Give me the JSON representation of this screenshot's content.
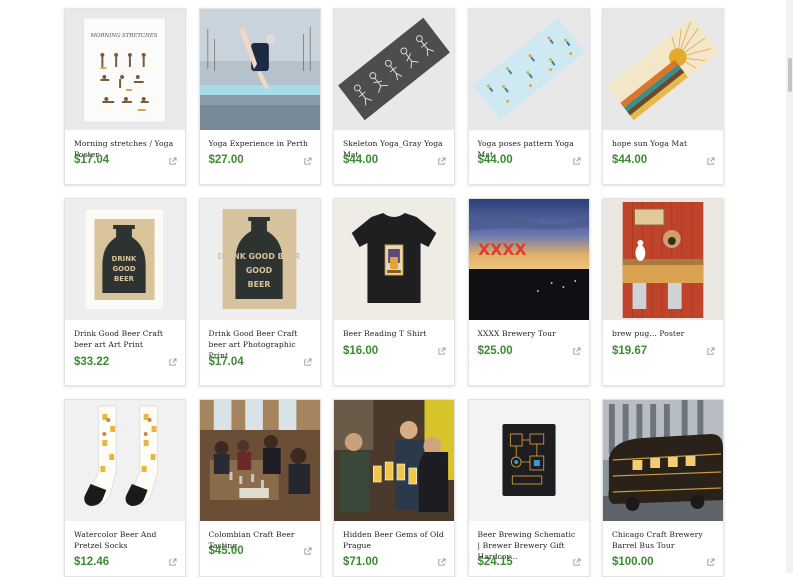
{
  "products": [
    {
      "title": "Morning stretches / Yoga Poster",
      "price": "$17.04",
      "image": "morning-stretches-poster"
    },
    {
      "title": "Yoga Experience in Perth",
      "price": "$27.00",
      "image": "yoga-paddleboard-photo"
    },
    {
      "title": "Skeleton Yoga_Gray Yoga Mat",
      "price": "$44.00",
      "image": "skeleton-yoga-mat"
    },
    {
      "title": "Yoga poses pattern Yoga Mat",
      "price": "$44.00",
      "image": "yoga-poses-mat"
    },
    {
      "title": "hope sun Yoga Mat",
      "price": "$44.00",
      "image": "hope-sun-mat"
    },
    {
      "title": "Drink Good Beer Craft beer art Art Print",
      "price": "$33.22",
      "image": "beer-growler-art-print"
    },
    {
      "title": "Drink Good Beer Craft beer art Photographic Print",
      "price": "$17.04",
      "image": "beer-growler-photo-print"
    },
    {
      "title": "Beer Reading T Shirt",
      "price": "$16.00",
      "image": "beer-tshirt"
    },
    {
      "title": "XXXX Brewery Tour",
      "price": "$25.00",
      "image": "xxxx-brewery-photo"
    },
    {
      "title": "brew pug... Poster",
      "price": "$19.67",
      "image": "brew-pug-poster"
    },
    {
      "title": "Watercolor Beer And Pretzel Socks",
      "price": "$12.46",
      "image": "beer-socks"
    },
    {
      "title": "Colombian Craft Beer Tasting",
      "price": "$45.00",
      "image": "beer-tasting-photo"
    },
    {
      "title": "Hidden Beer Gems of Old Prague",
      "price": "$71.00",
      "image": "prague-beer-photo"
    },
    {
      "title": "Beer Brewing Schematic | Brewer Brewery Gift Hardcov...",
      "price": "$24.15",
      "image": "brewing-notebook"
    },
    {
      "title": "Chicago Craft Brewery Barrel Bus Tour",
      "price": "$100.00",
      "image": "barrel-bus-photo"
    }
  ],
  "poster_text": "MORNING STRETCHES",
  "mug_text": "DRINK GOOD BEER",
  "sign_text": "XXXX",
  "colors": {
    "price": "#3d8b33",
    "text": "#222222",
    "border": "#e3e3e3"
  }
}
